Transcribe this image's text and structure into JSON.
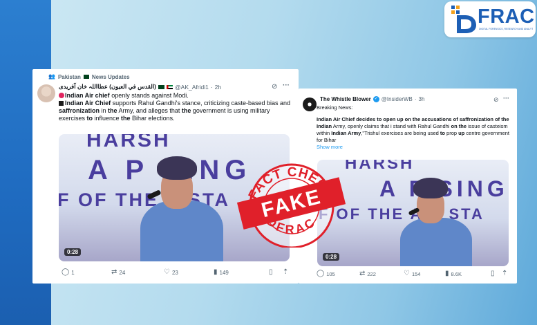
{
  "logo": {
    "text": "FRAC",
    "subtitle": "DIGITAL FORENSICS, RESEARCH AND ANALYTICS CENTRE"
  },
  "left_tweet": {
    "context_label": "Pakistan",
    "context_community": "News Updates",
    "display_name": "(القدس في العيون) عطااللہ خان آفریدی",
    "handle": "@AK_Afridi1",
    "time": "2h",
    "line1_bold": "Indian Air chief",
    "line1_rest": " openly stands against Modi.",
    "para2_a": "Indian Air Chief",
    "para2_b": " supports Rahul Gandhi's stance, criticizing caste-based bias and ",
    "para2_c": "saffronization",
    "para2_d": " in ",
    "para2_e": "the",
    "para2_f": " Army, and alleges that ",
    "para2_g": "the",
    "para2_h": " government is using military exercises ",
    "para2_i": "to",
    "para2_j": " influence ",
    "para2_k": "the",
    "para2_l": " Bihar elections.",
    "video_duration": "0:28",
    "bg_line1": "HARSH",
    "bg_line2": "A P SING",
    "bg_line3": "F OF THE   S STA",
    "replies": "1",
    "reposts": "24",
    "likes": "23",
    "views": "149"
  },
  "right_tweet": {
    "display_name": "The Whistle Blower",
    "handle": "@InsiderWB",
    "time": "3h",
    "intro": "Breaking News:",
    "t1": "Indian Air Chief decides to open up on the accusations of saffronization of the Indian",
    "t2": " Army, openly claims that i stand with Rahul Gandhi ",
    "t3": "on the",
    "t4": " issue of casteism within ",
    "t5": "Indian Army",
    "t6": ",\"Trishul exercises are being used ",
    "t7": "to",
    "t8": " prop ",
    "t9": "up",
    "t10": " centre government for Bihar",
    "show_more": "Show more",
    "video_duration": "0:28",
    "bg_line1": "HARSH",
    "bg_line2": "A P SINGH",
    "bg_line3": "F OF THE AIR STA",
    "replies": "105",
    "reposts": "222",
    "likes": "154",
    "views": "8.6K"
  },
  "stamp": {
    "top_text": "FACT CHECK",
    "center_text": "FAKE",
    "bottom_text": "DFRAC",
    "color": "#e0202a"
  },
  "colors": {
    "brand_blue": "#1d5fb5",
    "link_blue": "#1d9bf0",
    "left_band": "#2c7fd0"
  }
}
